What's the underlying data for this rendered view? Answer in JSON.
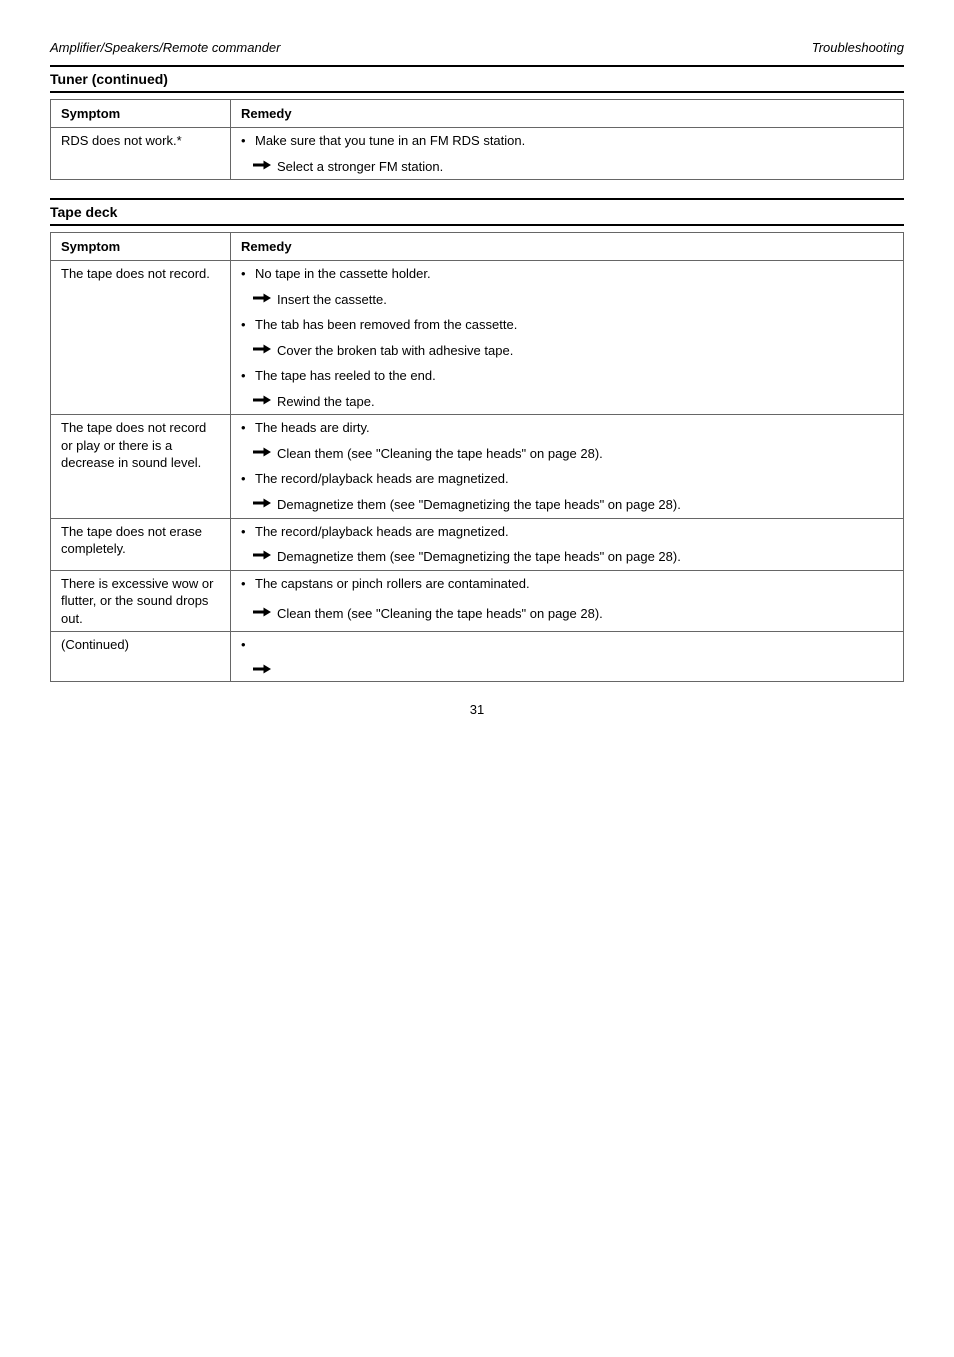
{
  "header": {
    "left": "Amplifier/Speakers/Remote commander",
    "right": "Troubleshooting"
  },
  "sections": [
    {
      "title": "Tuner (continued)",
      "columns": {
        "symptom": "Symptom",
        "remedy": "Remedy"
      },
      "groups": [
        {
          "symptom": "RDS does not work.*",
          "items": [
            {
              "cause": "Make sure that you tune in an FM RDS station.",
              "action": "Select a stronger FM station."
            }
          ]
        }
      ]
    },
    {
      "title": "Tape deck",
      "columns": {
        "symptom": "Symptom",
        "remedy": "Remedy"
      },
      "groups": [
        {
          "symptom": "The tape does not record.",
          "items": [
            {
              "cause": "No tape in the cassette holder.",
              "action": "Insert the cassette."
            },
            {
              "cause": "The tab has been removed from the cassette.",
              "action": "Cover the broken tab with adhesive tape."
            },
            {
              "cause": "The tape has reeled to the end.",
              "action": "Rewind the tape."
            }
          ]
        },
        {
          "symptom": "The tape does not record or play or there is a decrease in sound level.",
          "items": [
            {
              "cause": "The heads are dirty.",
              "action": "Clean them (see \"Cleaning the tape heads\" on page 28)."
            },
            {
              "cause": "The record/playback heads are magnetized.",
              "action": "Demagnetize them (see \"Demagnetizing the tape heads\" on page 28)."
            }
          ]
        },
        {
          "symptom": "The tape does not erase completely.",
          "items": [
            {
              "cause": "The record/playback heads are magnetized.",
              "action": "Demagnetize them (see \"Demagnetizing the tape heads\" on page 28)."
            }
          ]
        },
        {
          "symptom": "There is excessive wow or flutter, or the sound drops out.",
          "items": [
            {
              "cause": "The capstans or pinch rollers are contaminated.",
              "action": "Clean them (see \"Cleaning the tape heads\" on page 28)."
            }
          ]
        },
        {
          "symptom": "(Continued)",
          "items": [
            {
              "cause": "",
              "action": ""
            }
          ]
        }
      ]
    }
  ],
  "footnote": "",
  "page_number": "31"
}
